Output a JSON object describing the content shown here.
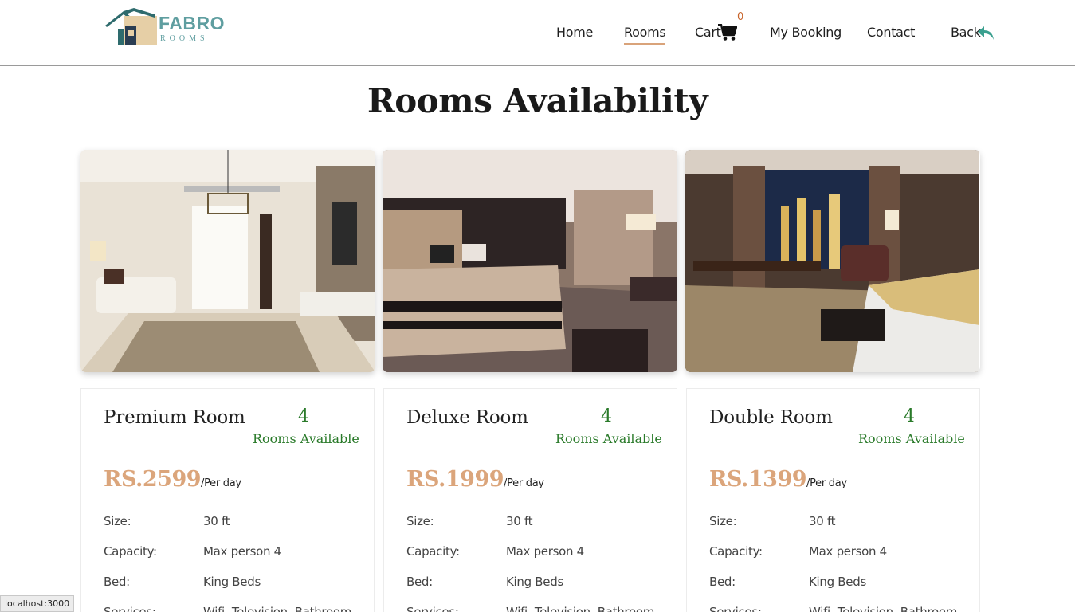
{
  "loading": {
    "progress": 0.2
  },
  "brand": {
    "name": "FABRO",
    "sub": "ROOMS",
    "color": "#5f9ea0"
  },
  "nav": {
    "items": [
      {
        "label": "Home",
        "active": false
      },
      {
        "label": "Rooms",
        "active": true
      },
      {
        "label": "Cart",
        "active": false
      },
      {
        "label": "My Booking",
        "active": false
      },
      {
        "label": "Contact",
        "active": false
      },
      {
        "label": "Back",
        "active": false
      }
    ],
    "cart_count": "0",
    "icons": {
      "cart": "cart-icon",
      "back": "reply-arrow-icon"
    }
  },
  "page": {
    "title": "Rooms Availability"
  },
  "rooms": [
    {
      "name": "Premium Room",
      "available": "4",
      "available_label": "Rooms Available",
      "price": "RS.2599",
      "per": "/Per day",
      "specs": [
        {
          "label": "Size:",
          "value": "30 ft"
        },
        {
          "label": "Capacity:",
          "value": "Max person 4"
        },
        {
          "label": "Bed:",
          "value": "King Beds"
        },
        {
          "label": "Services:",
          "value": "Wifi, Television, Bathroom"
        }
      ]
    },
    {
      "name": "Deluxe Room",
      "available": "4",
      "available_label": "Rooms Available",
      "price": "RS.1999",
      "per": "/Per day",
      "specs": [
        {
          "label": "Size:",
          "value": "30 ft"
        },
        {
          "label": "Capacity:",
          "value": "Max person 4"
        },
        {
          "label": "Bed:",
          "value": "King Beds"
        },
        {
          "label": "Services:",
          "value": "Wifi, Television, Bathroom"
        }
      ]
    },
    {
      "name": "Double Room",
      "available": "4",
      "available_label": "Rooms Available",
      "price": "RS.1399",
      "per": "/Per day",
      "specs": [
        {
          "label": "Size:",
          "value": "30 ft"
        },
        {
          "label": "Capacity:",
          "value": "Max person 4"
        },
        {
          "label": "Bed:",
          "value": "King Beds"
        },
        {
          "label": "Services:",
          "value": "Wifi, Television, Bathroom"
        }
      ]
    }
  ],
  "colors": {
    "accent": "#dba57b",
    "available": "#2a7a2a",
    "cart_badge": "#c9662d"
  },
  "status": {
    "url": "localhost:3000"
  }
}
